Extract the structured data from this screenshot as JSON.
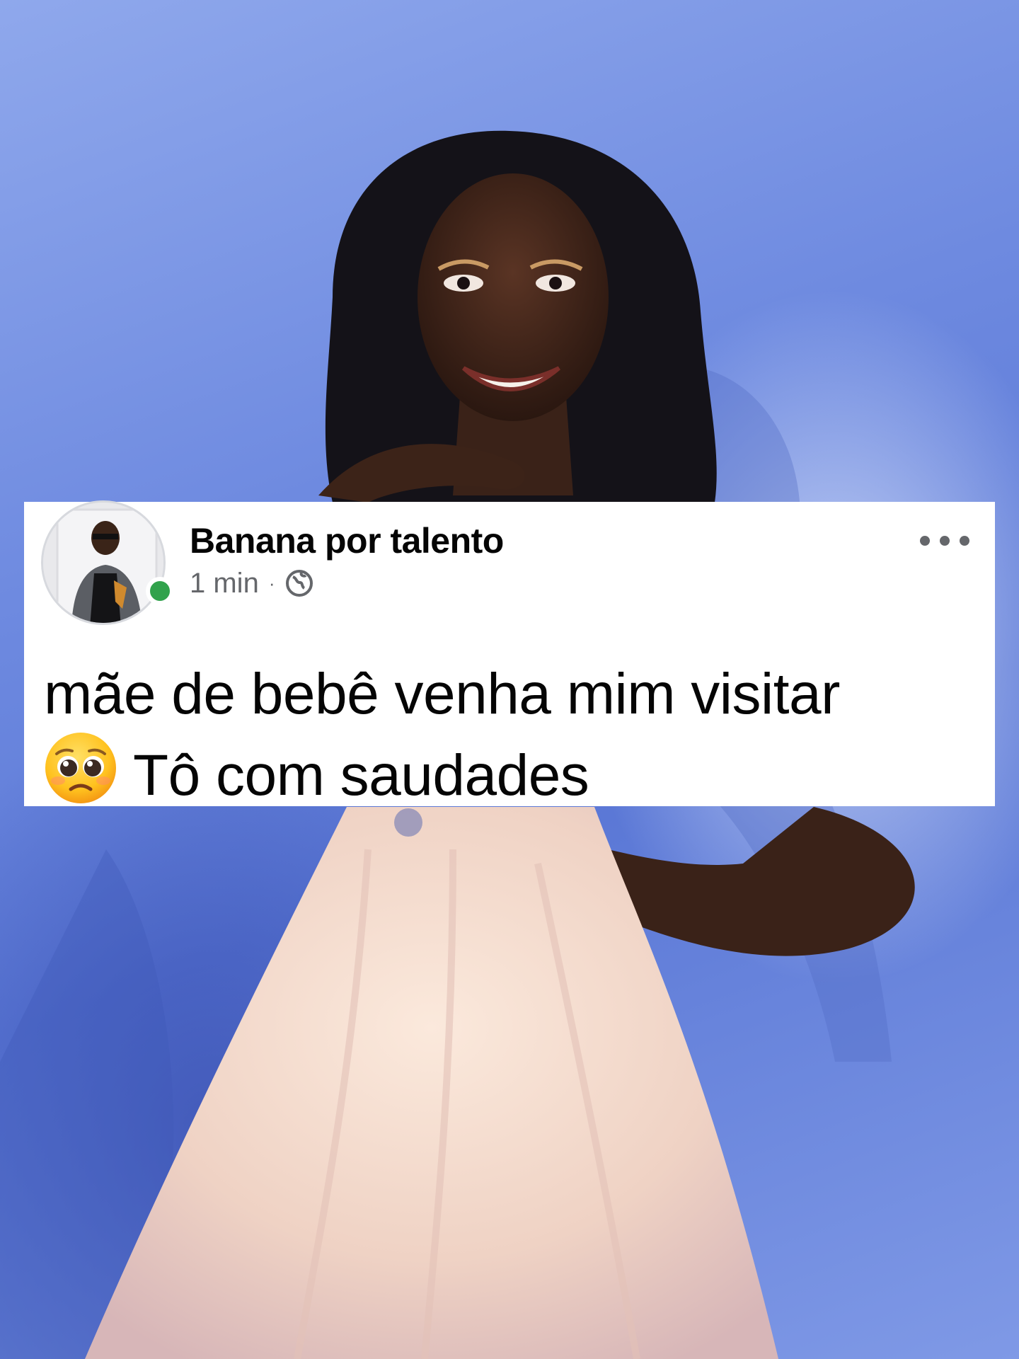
{
  "background_photo": {
    "description_icon": "portrait-photo",
    "colors": {
      "backdrop": "#6f8be0",
      "dress": "#f3dccd",
      "skin": "#3a2218",
      "hair": "#121015"
    }
  },
  "post": {
    "author_name": "Banana por talento",
    "timestamp": "1 min",
    "separator": "·",
    "privacy_icon": "globe-icon",
    "more_icon": "more-options-icon",
    "online_status_color": "#31a24c",
    "text_line1": "mãe de bebê venha mim visitar",
    "text_line2": "Tô com saudades",
    "emoji": "pleading-face-emoji"
  }
}
